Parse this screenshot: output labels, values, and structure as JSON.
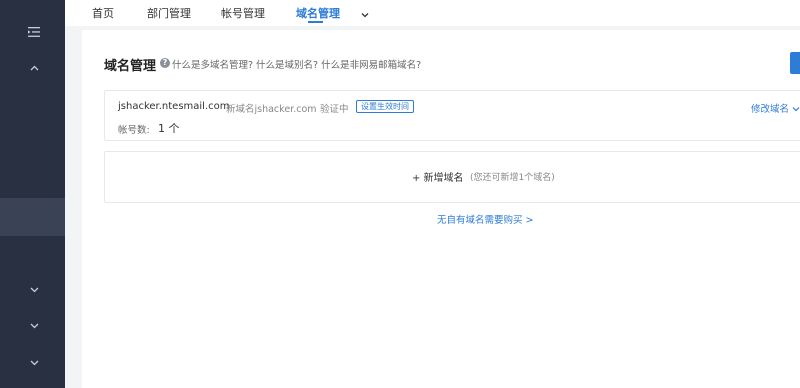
{
  "colors": {
    "sidebar": "#283042",
    "accent": "#2d7cd6",
    "background": "#f3f4f6"
  },
  "sidebar": {
    "icons": [
      "menu-collapse-icon",
      "chevron-up-icon",
      "chevron-down-icon",
      "chevron-down-icon",
      "chevron-down-icon"
    ]
  },
  "nav": {
    "tabs": [
      {
        "label": "首页",
        "active": false
      },
      {
        "label": "部门管理",
        "active": false
      },
      {
        "label": "帐号管理",
        "active": false
      },
      {
        "label": "域名管理",
        "active": true
      }
    ],
    "more_icon": "chevron-down-icon"
  },
  "page": {
    "title": "域名管理",
    "help_icon": "question-circle-icon",
    "help_text": "什么是多域名管理? 什么是域别名? 什么是非网易邮箱域名?"
  },
  "domain": {
    "name": "jshacker.ntesmail.com",
    "new_domain": "新域名jshacker.com",
    "status": "验证中",
    "set_effective_time": "设置生效时间",
    "edit_label": "修改域名",
    "account_label": "帐号数:",
    "account_count": "1 个"
  },
  "add_domain": {
    "label": "+ 新增域名",
    "hint": "(您还可新增1个域名)"
  },
  "buy_link": "无自有域名需要购买 >"
}
